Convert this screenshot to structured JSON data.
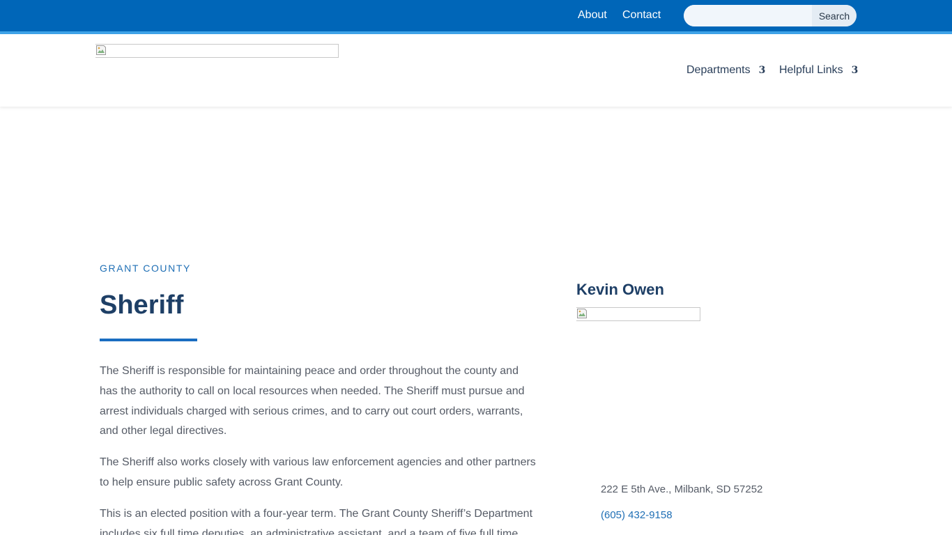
{
  "topbar": {
    "links": [
      {
        "label": "About"
      },
      {
        "label": "Contact"
      }
    ],
    "search": {
      "placeholder": "",
      "value": "",
      "button_label": "Search"
    }
  },
  "nav": {
    "items": [
      {
        "label": "Departments",
        "arrow": "3"
      },
      {
        "label": "Helpful Links",
        "arrow": "3"
      }
    ]
  },
  "content": {
    "eyebrow": "GRANT COUNTY",
    "title": "Sheriff",
    "paragraphs": [
      "The Sheriff is responsible for maintaining peace and order throughout the county and has the authority to call on local resources when needed. The Sheriff must pursue and arrest individuals charged with serious crimes, and to carry out court orders, warrants, and other legal directives.",
      "The Sheriff also works closely with various law enforcement agencies and other partners to help ensure public safety across Grant County.",
      "This is an elected position with a four-year term. The Grant County Sheriff’s Department includes six full time deputies, an administrative assistant, and a team of five full time"
    ]
  },
  "sidebar": {
    "name": "Kevin Owen",
    "address": "222 E 5th Ave., Milbank, SD 57252",
    "phone": "(605) 432-9158"
  },
  "colors": {
    "topbar": "#0066b8",
    "accent": "#3fa3e8",
    "heading": "#1e3f66",
    "link": "#1f6fb5"
  }
}
